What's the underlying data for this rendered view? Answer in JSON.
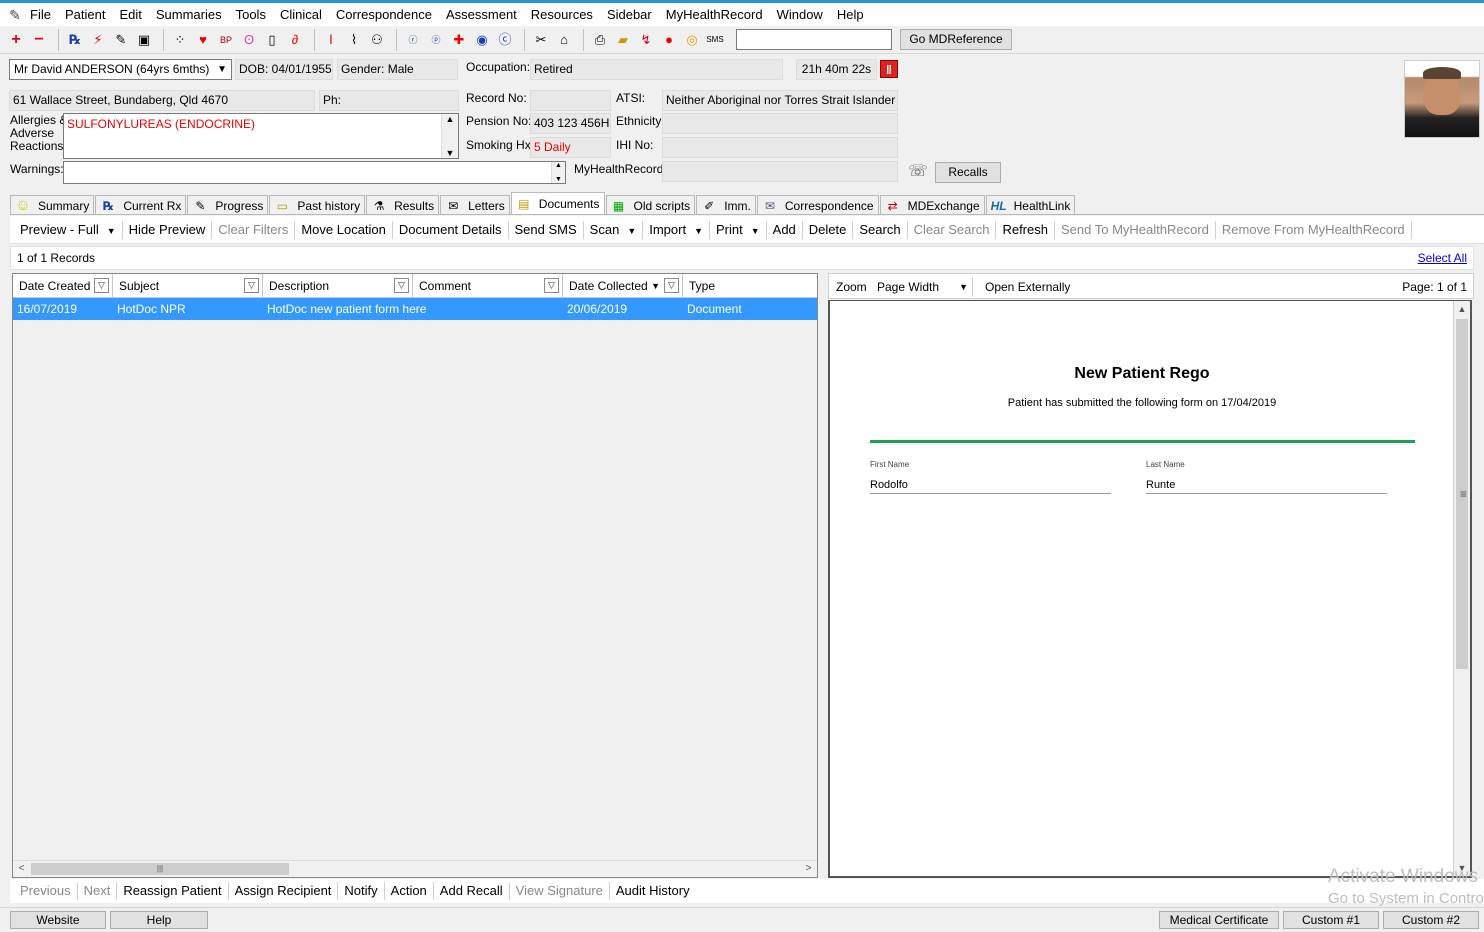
{
  "menu": {
    "items": [
      "File",
      "Patient",
      "Edit",
      "Summaries",
      "Tools",
      "Clinical",
      "Correspondence",
      "Assessment",
      "Resources",
      "Sidebar",
      "MyHealthRecord",
      "Window",
      "Help"
    ]
  },
  "toolbar": {
    "search_value": "",
    "go_label": "Go MDReference"
  },
  "patient": {
    "name": "Mr David ANDERSON (64yrs 6mths)",
    "dob": "DOB: 04/01/1955",
    "gender": "Gender: Male",
    "occupation_label": "Occupation:",
    "occupation": "Retired",
    "timer": "21h 40m 22s",
    "address": "61 Wallace Street, Bundaberg, Qld  4670",
    "phone": "Ph:",
    "record_no_label": "Record No:",
    "record_no": "",
    "atsi_label": "ATSI:",
    "atsi": "Neither Aboriginal nor Torres Strait Islander",
    "allergies_label_1": "Allergies &",
    "allergies_label_2": "Adverse",
    "allergies_label_3": "Reactions:",
    "allergies": "SULFONYLUREAS (ENDOCRINE)",
    "pension_label": "Pension No:",
    "pension": "403 123 456H",
    "ethnicity_label": "Ethnicity:",
    "ethnicity": "",
    "smoking_label": "Smoking Hx:",
    "smoking": "5 Daily",
    "ihi_label": "IHI No:",
    "ihi": "",
    "warnings_label": "Warnings:",
    "mhr_label": "MyHealthRecord:",
    "mhr": "",
    "recalls_label": "Recalls"
  },
  "tabs": [
    {
      "label": "Summary",
      "icon": "☺"
    },
    {
      "label": "Current Rx",
      "icon": "℞"
    },
    {
      "label": "Progress",
      "icon": "✎"
    },
    {
      "label": "Past history",
      "icon": "▭"
    },
    {
      "label": "Results",
      "icon": "⚗"
    },
    {
      "label": "Letters",
      "icon": "✉"
    },
    {
      "label": "Documents",
      "icon": "▤"
    },
    {
      "label": "Old scripts",
      "icon": "▦"
    },
    {
      "label": "Imm.",
      "icon": "✐"
    },
    {
      "label": "Correspondence",
      "icon": "✉"
    },
    {
      "label": "MDExchange",
      "icon": "⇄"
    },
    {
      "label": "HealthLink",
      "icon": "HL"
    }
  ],
  "doc_toolbar": {
    "preview": "Preview - Full",
    "hide_preview": "Hide Preview",
    "clear_filters": "Clear Filters",
    "move_location": "Move Location",
    "document_details": "Document Details",
    "send_sms": "Send SMS",
    "scan": "Scan",
    "import": "Import",
    "print": "Print",
    "add": "Add",
    "delete": "Delete",
    "search": "Search",
    "clear_search": "Clear Search",
    "refresh": "Refresh",
    "send_mhr": "Send To MyHealthRecord",
    "remove_mhr": "Remove From MyHealthRecord"
  },
  "records": {
    "count": "1 of 1 Records",
    "select_all": "Select All"
  },
  "grid": {
    "columns": [
      "Date Created",
      "Subject",
      "Description",
      "Comment",
      "Date Collected",
      "Type"
    ],
    "rows": [
      {
        "date_created": "16/07/2019",
        "subject": "HotDoc NPR",
        "description": "HotDoc new patient form here",
        "comment": "",
        "date_collected": "20/06/2019",
        "type": "Document"
      }
    ]
  },
  "preview": {
    "zoom_label": "Zoom",
    "zoom_value": "Page Width",
    "open_externally": "Open Externally",
    "page_info": "Page: 1 of 1",
    "form_title": "New Patient Rego",
    "form_subtitle": "Patient has submitted the following form on 17/04/2019",
    "first_name_label": "First Name",
    "first_name": "Rodolfo",
    "last_name_label": "Last Name",
    "last_name": "Runte"
  },
  "bottom_actions": {
    "previous": "Previous",
    "next": "Next",
    "reassign": "Reassign Patient",
    "assign_recipient": "Assign Recipient",
    "notify": "Notify",
    "action": "Action",
    "add_recall": "Add Recall",
    "view_signature": "View Signature",
    "audit_history": "Audit History"
  },
  "statusbar": {
    "website": "Website",
    "help": "Help",
    "medical_certificate": "Medical Certificate",
    "custom1": "Custom #1",
    "custom2": "Custom #2"
  },
  "watermark": {
    "line1": "Activate Windows",
    "line2": "Go to System in Control"
  }
}
